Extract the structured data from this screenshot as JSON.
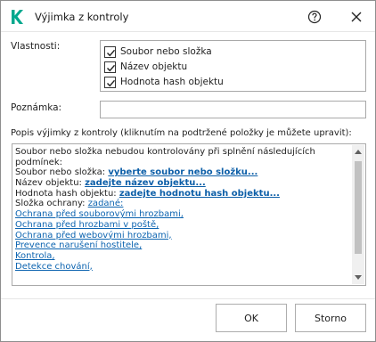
{
  "window": {
    "title": "Výjimka z kontroly",
    "accent_color": "#00a88e"
  },
  "properties": {
    "label": "Vlastnosti:",
    "options": [
      {
        "label": "Soubor nebo složka",
        "checked": true
      },
      {
        "label": "Název objektu",
        "checked": true
      },
      {
        "label": "Hodnota hash objektu",
        "checked": true
      }
    ]
  },
  "note": {
    "label": "Poznámka:",
    "value": "",
    "placeholder": ""
  },
  "description": {
    "label": "Popis výjimky z kontroly (kliknutím na podtržené položky je můžete upravit):",
    "intro_line1": "Soubor nebo složka nebudou kontrolovány při splnění následujících",
    "intro_line2": "podmínek:",
    "file_prefix": "Soubor nebo složka: ",
    "file_link": "vyberte soubor nebo složku...",
    "name_prefix": "Název objektu: ",
    "name_link": "zadejte název objektu...",
    "hash_prefix": "Hodnota hash objektu: ",
    "hash_link": "zadejte hodnotu hash objektu...",
    "component_prefix": "Složka ochrany: ",
    "component_link": "zadané:",
    "components": [
      "Ochrana před souborovými hrozbami,",
      "Ochrana před hrozbami v poště,",
      "Ochrana před webovými hrozbami,",
      "Prevence narušení hostitele,",
      "Kontrola,",
      "Detekce chování,"
    ]
  },
  "buttons": {
    "ok": "OK",
    "cancel": "Storno"
  }
}
